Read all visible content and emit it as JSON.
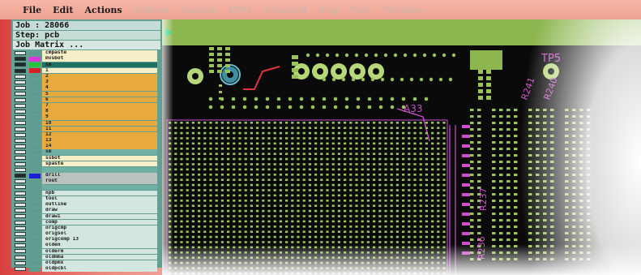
{
  "menu": {
    "items": [
      {
        "label": "File",
        "state": "active"
      },
      {
        "label": "Edit",
        "state": "active"
      },
      {
        "label": "Actions",
        "state": "active"
      },
      {
        "label": "Options",
        "state": "dim"
      },
      {
        "label": "Analysis",
        "state": "dim"
      },
      {
        "label": "DFM",
        "state": "dim"
      },
      {
        "label": "Advanced",
        "state": "dim"
      },
      {
        "label": "Step",
        "state": "dim"
      },
      {
        "label": "View",
        "state": "dim"
      },
      {
        "label": "Windows",
        "state": "dim"
      }
    ]
  },
  "job_panel": {
    "job": "Job : 28066",
    "step": "Step: pcb",
    "matrix": "Job Matrix ..."
  },
  "layers": [
    {
      "name": "cmpaste",
      "tone": "cream",
      "color": "",
      "on": false
    },
    {
      "name": "mvsbot",
      "tone": "cream",
      "color": "#d83bd4",
      "on": true
    },
    {
      "name": "sm",
      "tone": "dark",
      "color": "#27c13a",
      "on": true
    },
    {
      "name": "1",
      "tone": "cream",
      "color": "#d82024",
      "on": true
    },
    {
      "name": "2",
      "tone": "orange",
      "color": "",
      "on": false
    },
    {
      "name": "3",
      "tone": "orange",
      "color": "",
      "on": false
    },
    {
      "name": "4",
      "tone": "orange",
      "color": "",
      "on": false
    },
    {
      "name": "5",
      "tone": "orange",
      "color": "",
      "on": false
    },
    {
      "name": "6",
      "tone": "orange",
      "color": "",
      "on": false
    },
    {
      "name": "7",
      "tone": "orange",
      "color": "",
      "on": false
    },
    {
      "name": "8",
      "tone": "orange",
      "color": "",
      "on": false
    },
    {
      "name": "9",
      "tone": "orange",
      "color": "",
      "on": false
    },
    {
      "name": "10",
      "tone": "orange",
      "color": "",
      "on": false
    },
    {
      "name": "11",
      "tone": "orange",
      "color": "",
      "on": false
    },
    {
      "name": "12",
      "tone": "orange",
      "color": "",
      "on": false
    },
    {
      "name": "13",
      "tone": "orange",
      "color": "",
      "on": false
    },
    {
      "name": "14",
      "tone": "orange",
      "color": "",
      "on": false
    },
    {
      "name": "sm",
      "tone": "teal",
      "color": "",
      "on": false
    },
    {
      "name": "ssbot",
      "tone": "cream",
      "color": "",
      "on": false
    },
    {
      "name": "spaste",
      "tone": "cream",
      "color": "",
      "on": false
    },
    {
      "name": "",
      "tone": "teal",
      "color": "",
      "on": false
    },
    {
      "name": "drill",
      "tone": "grey",
      "color": "#1d1dd6",
      "on": true
    },
    {
      "name": "rout",
      "tone": "grey",
      "color": "",
      "on": false
    },
    {
      "name": "",
      "tone": "teal",
      "color": "",
      "on": false
    },
    {
      "name": "npb",
      "tone": "light",
      "color": "",
      "on": false
    },
    {
      "name": "tool",
      "tone": "light",
      "color": "",
      "on": false
    },
    {
      "name": "outline",
      "tone": "light",
      "color": "",
      "on": false
    },
    {
      "name": "draw",
      "tone": "light",
      "color": "",
      "on": false
    },
    {
      "name": "draw1",
      "tone": "light",
      "color": "",
      "on": false
    },
    {
      "name": "comp",
      "tone": "light",
      "color": "",
      "on": false
    },
    {
      "name": "origcmp",
      "tone": "light",
      "color": "",
      "on": false
    },
    {
      "name": "origsol",
      "tone": "light",
      "color": "",
      "on": false
    },
    {
      "name": "origcomp 13",
      "tone": "light",
      "color": "",
      "on": false
    },
    {
      "name": "olden",
      "tone": "light",
      "color": "",
      "on": false
    },
    {
      "name": "olderm",
      "tone": "light",
      "color": "",
      "on": false
    },
    {
      "name": "oldmma",
      "tone": "light",
      "color": "",
      "on": false
    },
    {
      "name": "oldpmx",
      "tone": "light",
      "color": "",
      "on": false
    },
    {
      "name": "oldpcbl",
      "tone": "light",
      "color": "",
      "on": false
    }
  ],
  "board": {
    "refdes": [
      {
        "id": "tp5",
        "text": "TP5"
      },
      {
        "id": "a33",
        "text": "A33"
      },
      {
        "id": "r241",
        "text": "R241"
      },
      {
        "id": "r240",
        "text": "R240"
      },
      {
        "id": "r237",
        "text": "R237"
      },
      {
        "id": "r236",
        "text": "R236"
      }
    ],
    "colors": {
      "background": "#0a0a0a",
      "top_band": "#8bb54e",
      "pad": "#9ac25a",
      "silkscreen": "#d04ed0",
      "trace": "#e0343c",
      "via": "#3f8fa0"
    }
  }
}
